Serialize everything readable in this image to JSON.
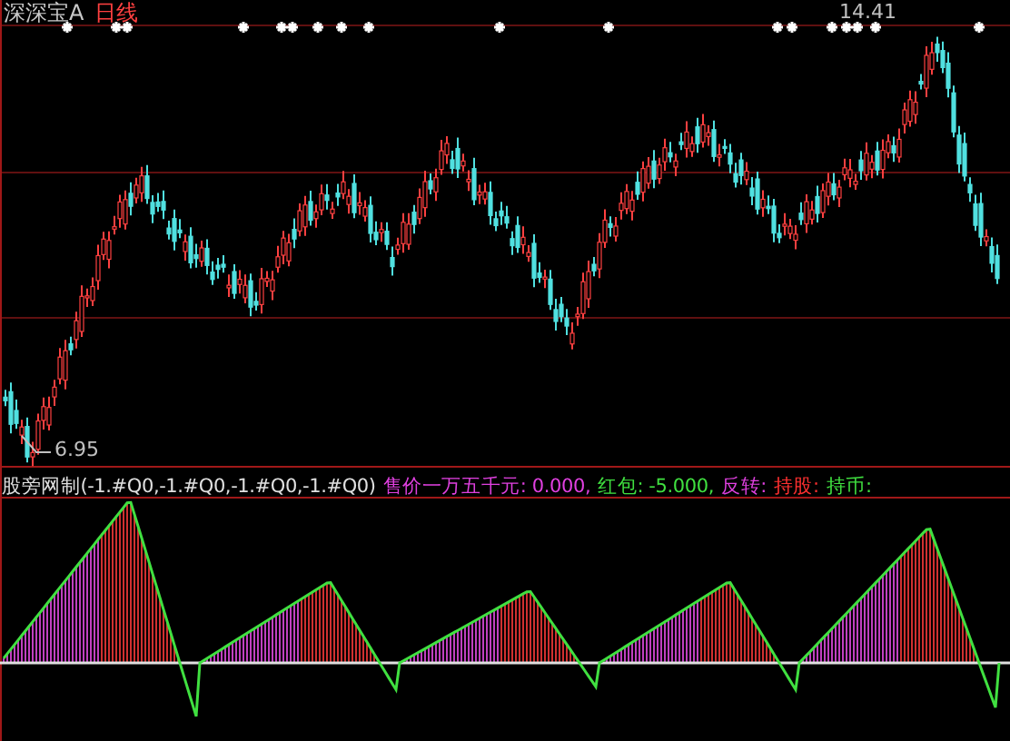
{
  "title": {
    "stock_name": "深深宝A",
    "period": "日线"
  },
  "price_chart": {
    "high_label": "14.41",
    "low_label": "6.95"
  },
  "indicator": {
    "name": "股旁网制(-1.#Q0,-1.#Q0,-1.#Q0,-1.#Q0)",
    "readouts": [
      {
        "text": "售价一万五千元: 0.000,",
        "color": "#e040e0"
      },
      {
        "text": "红包: -5.000,",
        "color": "#40e040"
      },
      {
        "text": "反转:",
        "color": "#e040e0"
      },
      {
        "text": "持股:",
        "color": "#ff3030"
      },
      {
        "text": "持币:",
        "color": "#40e040"
      }
    ]
  }
}
